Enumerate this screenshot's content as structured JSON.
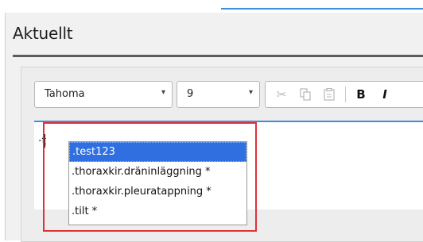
{
  "header": {
    "title": "Aktuellt"
  },
  "toolbar": {
    "font_name": "Tahoma",
    "font_size": "9",
    "dropdown_arrow": "▾",
    "bold_label": "B",
    "italic_label": "I"
  },
  "editor": {
    "typed_text": "·t"
  },
  "autocomplete": {
    "items": [
      ".test123",
      ".thoraxkir.dräninläggning *",
      ".thoraxkir.pleuratappning *",
      ".tilt *"
    ],
    "selected_index": 0
  },
  "colors": {
    "accent": "#3d8fd8",
    "selection": "#2f6fe0",
    "highlight_border": "#e0303a"
  },
  "icons": {
    "cut": "scissors-icon",
    "copy": "copy-icon",
    "paste": "paste-icon",
    "dropdown": "chevron-down-icon"
  }
}
